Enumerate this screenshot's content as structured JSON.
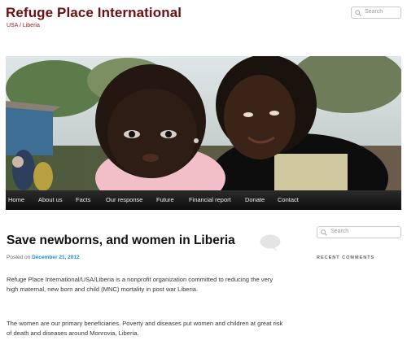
{
  "site": {
    "title": "Refuge Place International",
    "description": "USA / Liberia"
  },
  "header_search": {
    "placeholder": "Search",
    "icon": "search-icon"
  },
  "banner": {
    "alt": "A young woman holding a baby in Liberia"
  },
  "nav": {
    "items": [
      "Home",
      "About us",
      "Facts",
      "Our response",
      "Future",
      "Financial report",
      "Donate",
      "Contact"
    ]
  },
  "post": {
    "title": "Save newborns, and women in Liberia",
    "posted_on_label": "Posted on",
    "date": "December 21, 2012",
    "comment_icon": "comment-bubble-icon",
    "paragraphs": [
      "Refuge Place International/USA/Liberia is a nonprofit organization committed to reducing the very high maternal, new born and child (MNC) mortality in post war Liberia.",
      "The women are our primary beneficiaries. Poverty and diseases put women and children at great risk of death and diseases around Monrovia, Liberia."
    ]
  },
  "sidebar": {
    "search_placeholder": "Search",
    "recent_comments_heading": "RECENT COMMENTS"
  }
}
